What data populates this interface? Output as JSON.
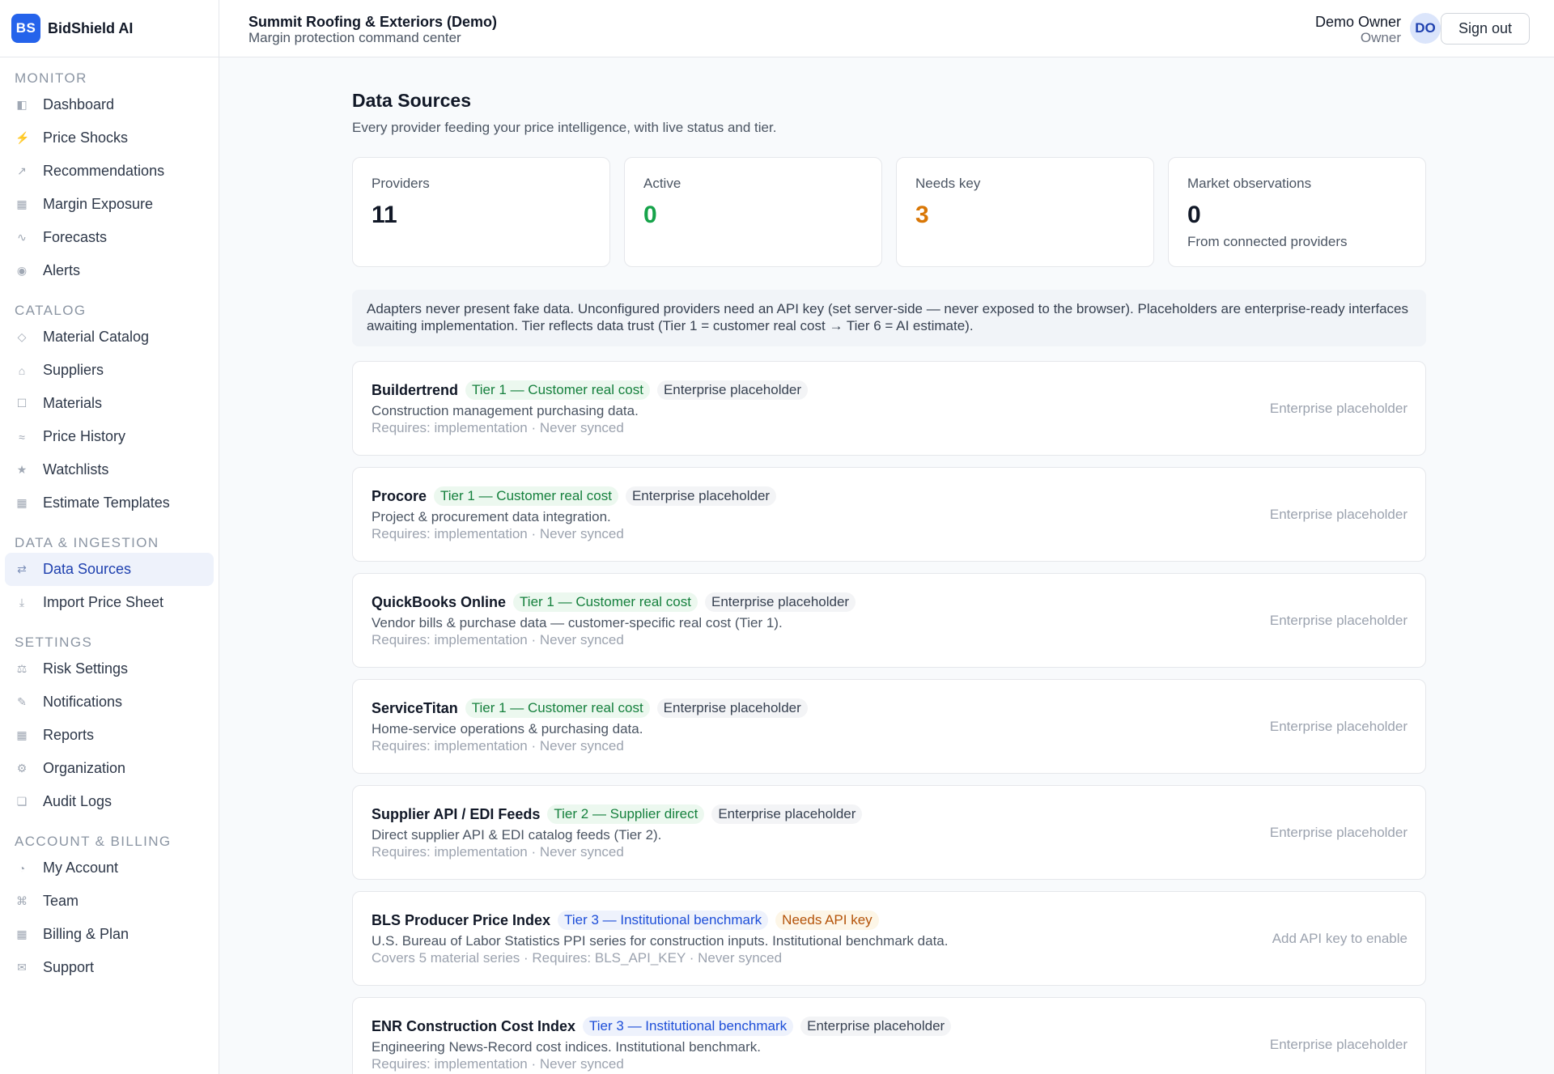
{
  "brand": {
    "logo": "BS",
    "name": "BidShield AI"
  },
  "header": {
    "org_name": "Summit Roofing & Exteriors (Demo)",
    "org_sub": "Margin protection command center",
    "user_name": "Demo Owner",
    "user_role": "Owner",
    "avatar": "DO",
    "signout": "Sign out"
  },
  "sidebar": {
    "sections": [
      {
        "title": "MONITOR",
        "items": [
          {
            "label": "Dashboard",
            "icon": "dashboard-icon",
            "glyph": "◧"
          },
          {
            "label": "Price Shocks",
            "icon": "lightning-icon",
            "glyph": "⚡"
          },
          {
            "label": "Recommendations",
            "icon": "arrow-up-right-icon",
            "glyph": "↗"
          },
          {
            "label": "Margin Exposure",
            "icon": "grid-icon",
            "glyph": "▦"
          },
          {
            "label": "Forecasts",
            "icon": "trend-icon",
            "glyph": "∿"
          },
          {
            "label": "Alerts",
            "icon": "alert-icon",
            "glyph": "◉"
          }
        ]
      },
      {
        "title": "CATALOG",
        "items": [
          {
            "label": "Material Catalog",
            "icon": "diamond-icon",
            "glyph": "◇"
          },
          {
            "label": "Suppliers",
            "icon": "home-icon",
            "glyph": "⌂"
          },
          {
            "label": "Materials",
            "icon": "box-icon",
            "glyph": "☐"
          },
          {
            "label": "Price History",
            "icon": "history-icon",
            "glyph": "≈"
          },
          {
            "label": "Watchlists",
            "icon": "star-icon",
            "glyph": "★"
          },
          {
            "label": "Estimate Templates",
            "icon": "template-icon",
            "glyph": "▦"
          }
        ]
      },
      {
        "title": "DATA & INGESTION",
        "items": [
          {
            "label": "Data Sources",
            "icon": "exchange-icon",
            "glyph": "⇄",
            "active": true
          },
          {
            "label": "Import Price Sheet",
            "icon": "download-icon",
            "glyph": "⤓"
          }
        ]
      },
      {
        "title": "SETTINGS",
        "items": [
          {
            "label": "Risk Settings",
            "icon": "scale-icon",
            "glyph": "⚖"
          },
          {
            "label": "Notifications",
            "icon": "pencil-icon",
            "glyph": "✎"
          },
          {
            "label": "Reports",
            "icon": "report-icon",
            "glyph": "▦"
          },
          {
            "label": "Organization",
            "icon": "gear-icon",
            "glyph": "⚙"
          },
          {
            "label": "Audit Logs",
            "icon": "log-icon",
            "glyph": "❏"
          }
        ]
      },
      {
        "title": "ACCOUNT & BILLING",
        "items": [
          {
            "label": "My Account",
            "icon": "account-icon",
            "glyph": "◔"
          },
          {
            "label": "Team",
            "icon": "team-icon",
            "glyph": "⌘"
          },
          {
            "label": "Billing & Plan",
            "icon": "billing-icon",
            "glyph": "▦"
          },
          {
            "label": "Support",
            "icon": "mail-icon",
            "glyph": "✉"
          }
        ]
      }
    ]
  },
  "main": {
    "title": "Data Sources",
    "subtitle": "Every provider feeding your price intelligence, with live status and tier.",
    "stats": [
      {
        "label": "Providers",
        "value": "11",
        "tone": ""
      },
      {
        "label": "Active",
        "value": "0",
        "tone": "green"
      },
      {
        "label": "Needs key",
        "value": "3",
        "tone": "orange"
      },
      {
        "label": "Market observations",
        "value": "0",
        "tone": "",
        "note": "From connected providers"
      }
    ],
    "notice": "Adapters never present fake data. Unconfigured providers need an API key (set server-side — never exposed to the browser). Placeholders are enterprise-ready interfaces awaiting implementation. Tier reflects data trust (Tier 1 = customer real cost → Tier 6 = AI estimate).",
    "providers": [
      {
        "name": "Buildertrend",
        "tier": "Tier 1 — Customer real cost",
        "tier_class": "t1",
        "tag": "Enterprise placeholder",
        "tag_class": "placeholder",
        "desc": "Construction management purchasing data.",
        "req": "Requires: implementation · Never synced",
        "status": "Enterprise placeholder"
      },
      {
        "name": "Procore",
        "tier": "Tier 1 — Customer real cost",
        "tier_class": "t1",
        "tag": "Enterprise placeholder",
        "tag_class": "placeholder",
        "desc": "Project & procurement data integration.",
        "req": "Requires: implementation · Never synced",
        "status": "Enterprise placeholder"
      },
      {
        "name": "QuickBooks Online",
        "tier": "Tier 1 — Customer real cost",
        "tier_class": "t1",
        "tag": "Enterprise placeholder",
        "tag_class": "placeholder",
        "desc": "Vendor bills & purchase data — customer-specific real cost (Tier 1).",
        "req": "Requires: implementation · Never synced",
        "status": "Enterprise placeholder"
      },
      {
        "name": "ServiceTitan",
        "tier": "Tier 1 — Customer real cost",
        "tier_class": "t1",
        "tag": "Enterprise placeholder",
        "tag_class": "placeholder",
        "desc": "Home-service operations & purchasing data.",
        "req": "Requires: implementation · Never synced",
        "status": "Enterprise placeholder"
      },
      {
        "name": "Supplier API / EDI Feeds",
        "tier": "Tier 2 — Supplier direct",
        "tier_class": "t2",
        "tag": "Enterprise placeholder",
        "tag_class": "placeholder",
        "desc": "Direct supplier API & EDI catalog feeds (Tier 2).",
        "req": "Requires: implementation · Never synced",
        "status": "Enterprise placeholder"
      },
      {
        "name": "BLS Producer Price Index",
        "tier": "Tier 3 — Institutional benchmark",
        "tier_class": "t3",
        "tag": "Needs API key",
        "tag_class": "needs",
        "desc": "U.S. Bureau of Labor Statistics PPI series for construction inputs. Institutional benchmark data.",
        "req": "Covers 5 material series · Requires: BLS_API_KEY · Never synced",
        "status": "Add API key to enable"
      },
      {
        "name": "ENR Construction Cost Index",
        "tier": "Tier 3 — Institutional benchmark",
        "tier_class": "t3",
        "tag": "Enterprise placeholder",
        "tag_class": "placeholder",
        "desc": "Engineering News-Record cost indices. Institutional benchmark.",
        "req": "Requires: implementation · Never synced",
        "status": "Enterprise placeholder"
      }
    ]
  }
}
